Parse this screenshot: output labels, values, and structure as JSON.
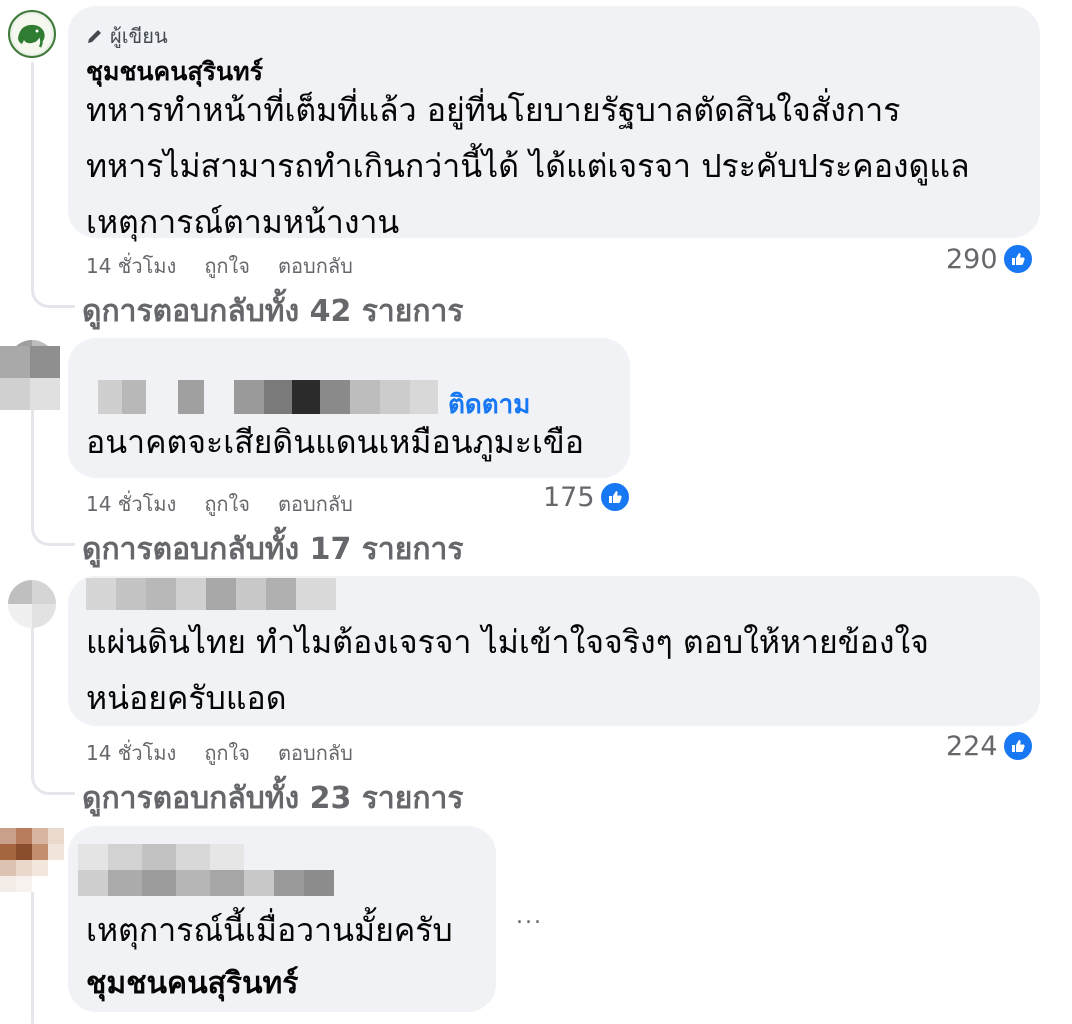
{
  "comments": [
    {
      "author_badge": "ผู้เขียน",
      "author_name": "ชุมชนคนสุรินทร์",
      "text_lines": [
        "ทหารทำหน้าที่เต็มที่แล้ว อยู่ที่นโยบายรัฐบาลตัดสินใจสั่งการ",
        "ทหารไม่สามารถทำเกินกว่านี้ได้ ได้แต่เจรจา ประคับประคองดูแล",
        "เหตุการณ์ตามหน้างาน"
      ],
      "time": "14 ชั่วโมง",
      "like_action": "ถูกใจ",
      "reply_action": "ตอบกลับ",
      "reaction_count": "290",
      "replies_label": "ดูการตอบกลับทั้ง 42 รายการ",
      "avatar_icon": "elephant-logo-icon"
    },
    {
      "follow_label": "ติดตาม",
      "text_lines": [
        "อนาคตจะเสียดินแดนเหมือนภูมะเขือ"
      ],
      "time": "14 ชั่วโมง",
      "like_action": "ถูกใจ",
      "reply_action": "ตอบกลับ",
      "reaction_count": "175",
      "replies_label": "ดูการตอบกลับทั้ง 17 รายการ"
    },
    {
      "text_lines": [
        "แผ่นดินไทย ทำไมต้องเจรจา ไม่เข้าใจจริงๆ ตอบให้หายข้องใจ",
        "หน่อยครับแอด"
      ],
      "time": "14 ชั่วโมง",
      "like_action": "ถูกใจ",
      "reply_action": "ตอบกลับ",
      "reaction_count": "224",
      "replies_label": "ดูการตอบกลับทั้ง 23 รายการ"
    },
    {
      "text_lines": [
        "เหตุการณ์นี้เมื่อวานมั้ยครับ"
      ],
      "mention": "ชุมชนคนสุรินทร์",
      "more_label": "..."
    }
  ],
  "colors": {
    "bubble": "#f0f2f5",
    "link_blue": "#1877f2",
    "meta_gray": "#65676b"
  }
}
